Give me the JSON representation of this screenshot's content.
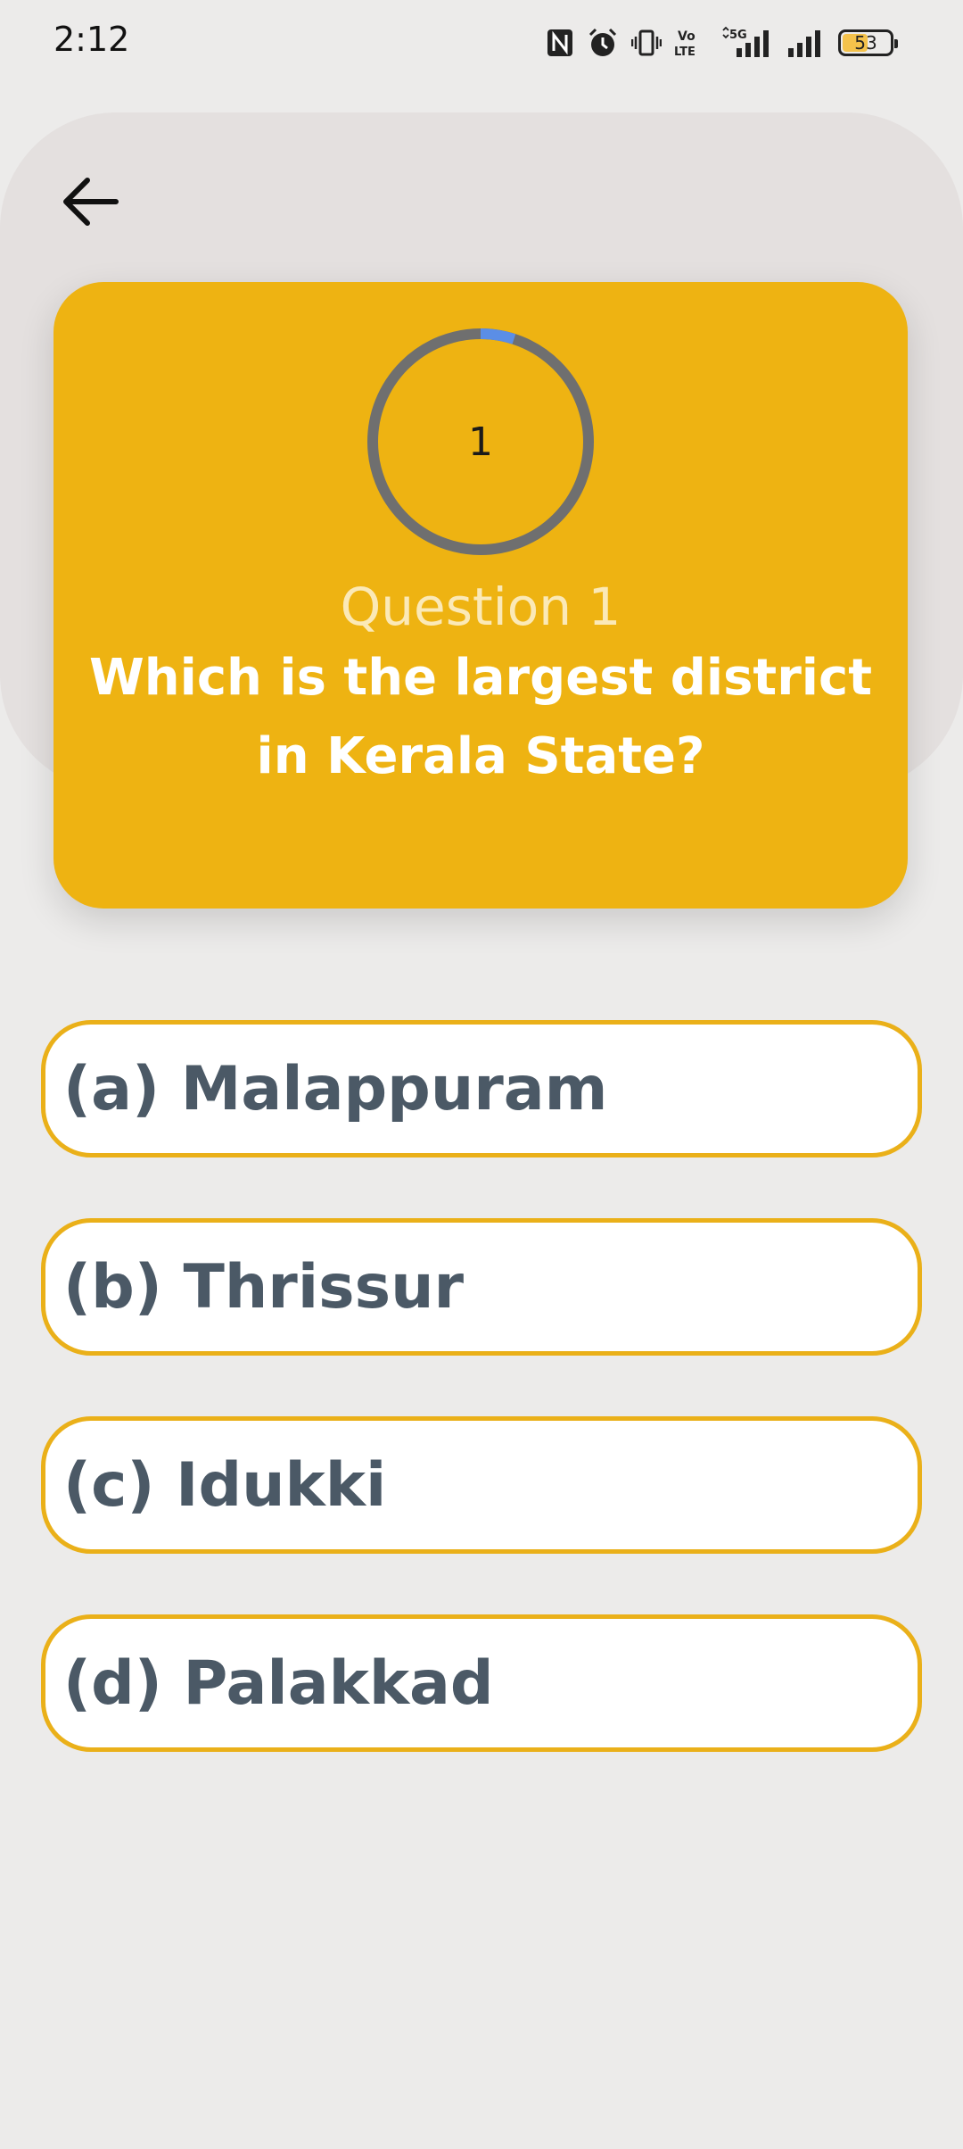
{
  "status_bar": {
    "time": "2:12",
    "icons": [
      "nfc-icon",
      "alarm-icon",
      "vibrate-icon",
      "volte-icon",
      "signal-5g-icon",
      "signal-icon",
      "battery-icon"
    ],
    "volte_label": "Vo LTE",
    "network_label": "5G",
    "battery_level": "53",
    "battery_fraction": 0.53
  },
  "header": {
    "back_icon": "arrow-left-icon"
  },
  "question_card": {
    "timer_value": "1",
    "timer_progress": 0.05,
    "question_number": "Question 1",
    "question_text": "Which is the largest district in Kerala State?",
    "colors": {
      "card": "#eeb312",
      "timer_track": "#6f6f6f",
      "timer_progress": "#5b8ee6"
    }
  },
  "options": [
    {
      "label": "(a) Malappuram"
    },
    {
      "label": "(b) Thrissur"
    },
    {
      "label": "(c) Idukki"
    },
    {
      "label": "(d) Palakkad"
    }
  ],
  "colors": {
    "background": "#ecebea",
    "option_border": "#eab019",
    "option_text": "#4b5966"
  }
}
